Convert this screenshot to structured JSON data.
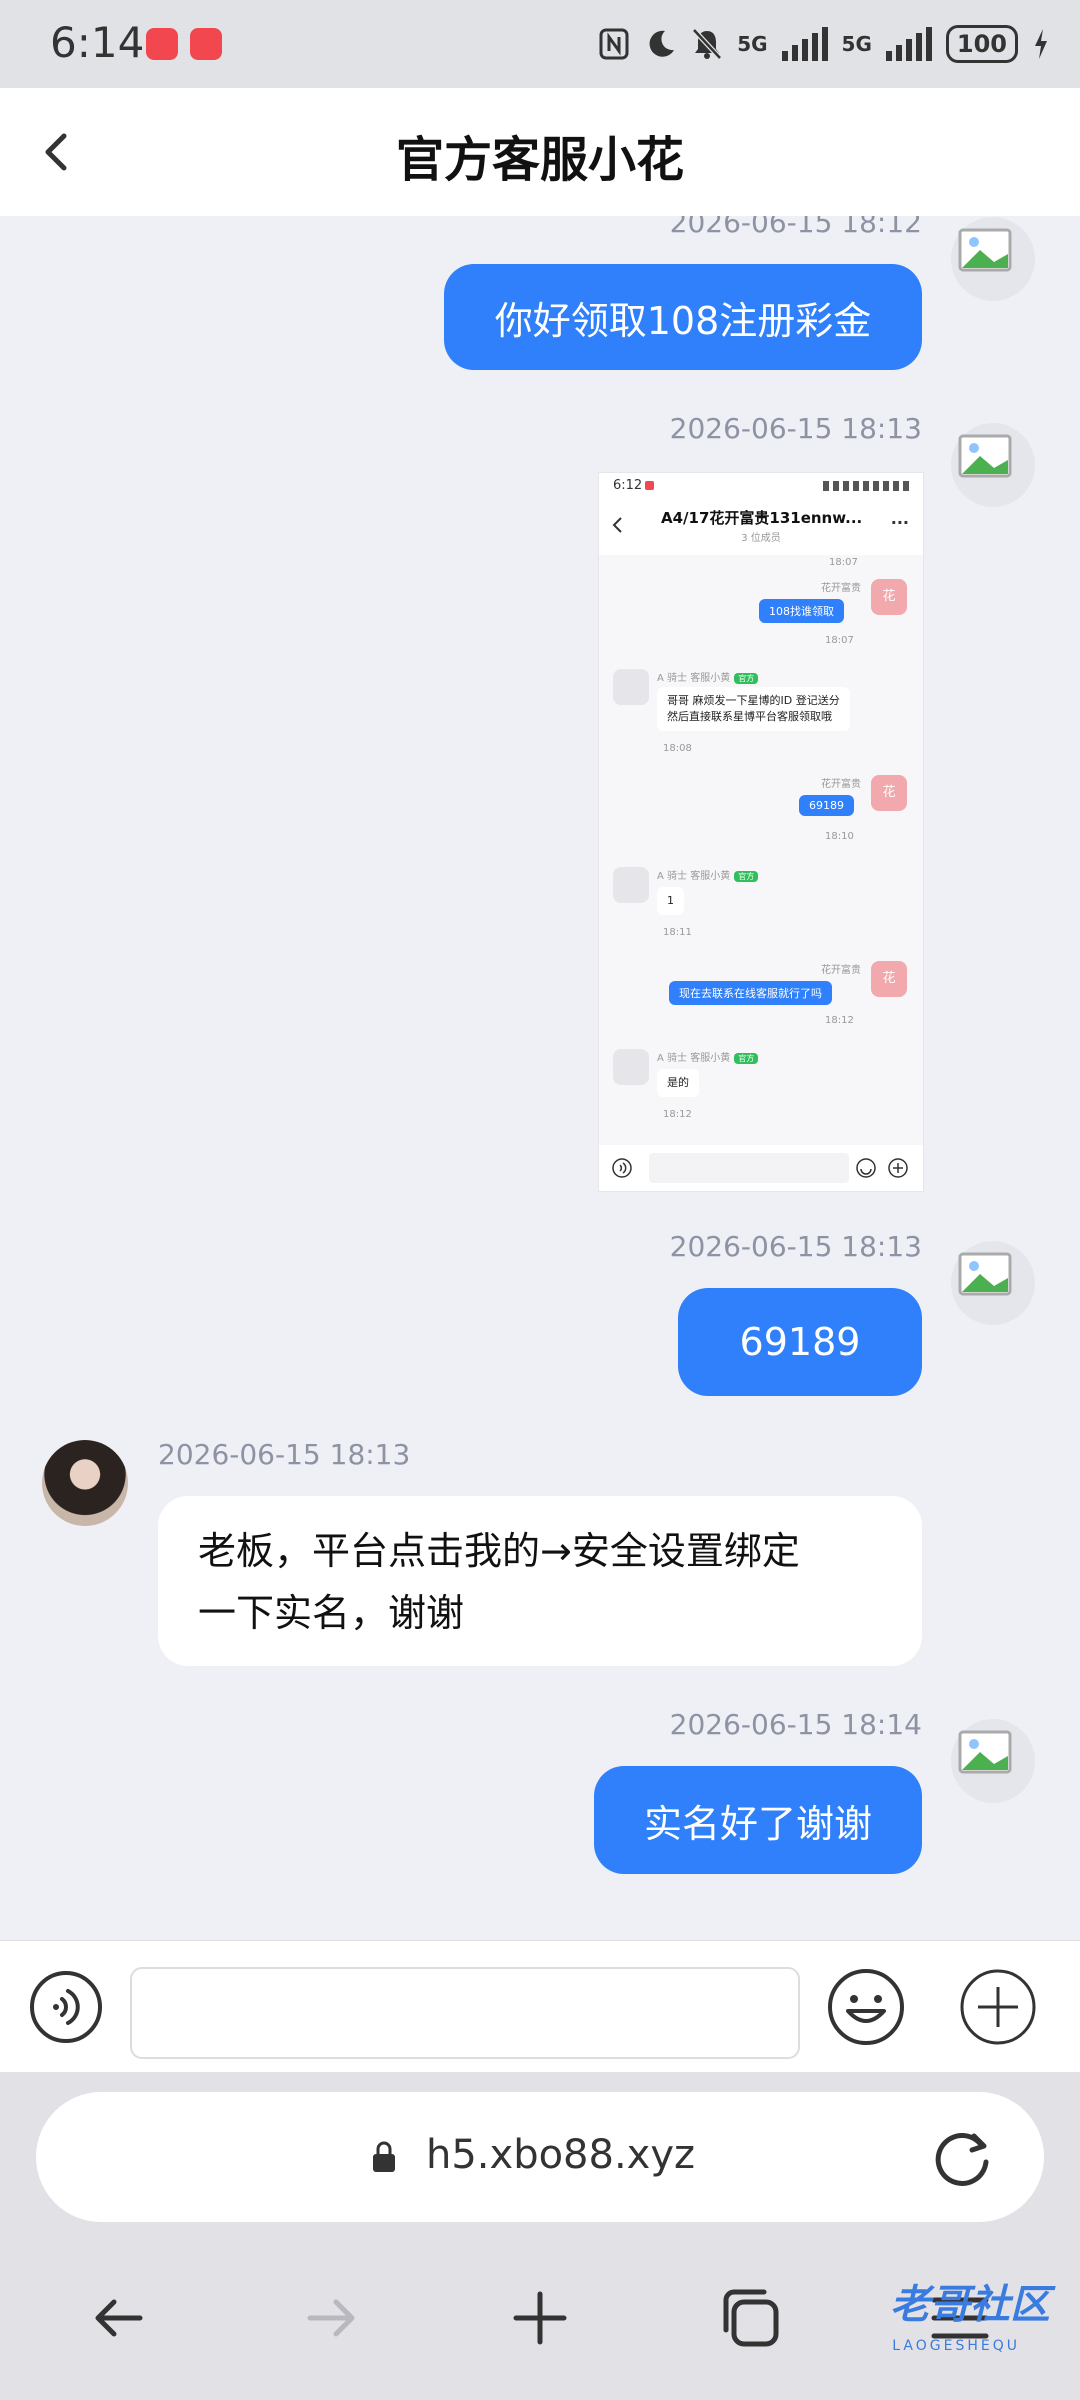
{
  "status_bar": {
    "time": "6:14",
    "network_5g_1": "5G",
    "network_5g_2": "5G",
    "battery": "100"
  },
  "header": {
    "title": "官方客服小花"
  },
  "messages": [
    {
      "timestamp": "2026-06-15 18:12",
      "text": "你好领取108注册彩金"
    },
    {
      "timestamp": "2026-06-15 18:13",
      "image": "screenshot"
    },
    {
      "timestamp": "2026-06-15 18:13",
      "text": "69189"
    },
    {
      "timestamp": "2026-06-15 18:13",
      "text_line1": "老板，平台点击我的→安全设置绑定",
      "text_line2": "一下实名，谢谢"
    },
    {
      "timestamp": "2026-06-15 18:14",
      "text": "实名好了谢谢"
    }
  ],
  "embedded_screenshot": {
    "status_time": "6:12",
    "title": "A4/17花开富贵131ennw...",
    "subtitle": "3 位成员",
    "more": "...",
    "time_top": "18:07",
    "sender_flower": "花开富贵",
    "avatar_flower": "花",
    "msg1": "108找谁领取",
    "msg1_time": "18:07",
    "sender_service": "A 骑士 客服小黄",
    "official_tag": "官方",
    "reply1_line1": "哥哥 麻烦发一下星博的ID 登记送分",
    "reply1_line2": "然后直接联系星博平台客服领取哦",
    "reply1_time": "18:08",
    "msg2": "69189",
    "msg2_time": "18:10",
    "reply2": "1",
    "reply2_time": "18:11",
    "msg3": "现在去联系在线客服就行了吗",
    "msg3_time": "18:12",
    "reply3": "是的",
    "reply3_time": "18:12"
  },
  "browser": {
    "url": "h5.xbo88.xyz"
  },
  "watermark": {
    "text": "老哥社区",
    "sub": "LAOGESHEQU"
  },
  "colors": {
    "accent": "#2F80FA",
    "background": "#EEF0F6"
  }
}
